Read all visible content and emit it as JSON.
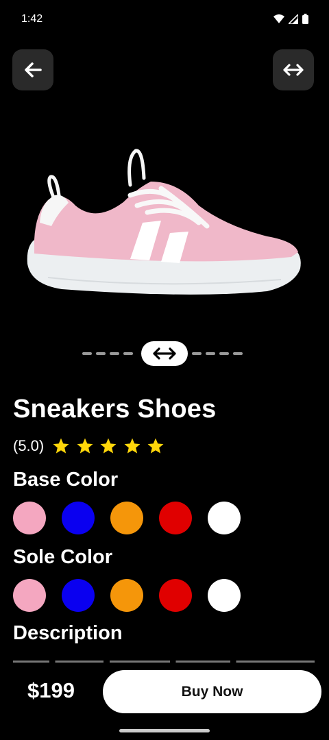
{
  "status": {
    "time": "1:42"
  },
  "header": {
    "back_icon": "arrow-left-icon",
    "rotate_icon": "swap-horizontal-icon"
  },
  "product": {
    "image": "pink-sneaker-illustration",
    "name": "Sneakers Shoes",
    "rating_text": "(5.0)",
    "rating": 5,
    "rating_max": 5,
    "star_color": "#FFD60A"
  },
  "rotation_slider": {
    "icon": "swap-horizontal-icon",
    "position": 0.5
  },
  "base_color": {
    "label": "Base Color",
    "options": [
      "#F4A7C0",
      "#0A00F0",
      "#F5960A",
      "#E00000",
      "#FFFFFF"
    ]
  },
  "sole_color": {
    "label": "Sole Color",
    "options": [
      "#F4A7C0",
      "#0A00F0",
      "#F5960A",
      "#E00000",
      "#FFFFFF"
    ]
  },
  "description": {
    "label": "Description"
  },
  "checkout": {
    "price": "$199",
    "buy_label": "Buy Now"
  }
}
